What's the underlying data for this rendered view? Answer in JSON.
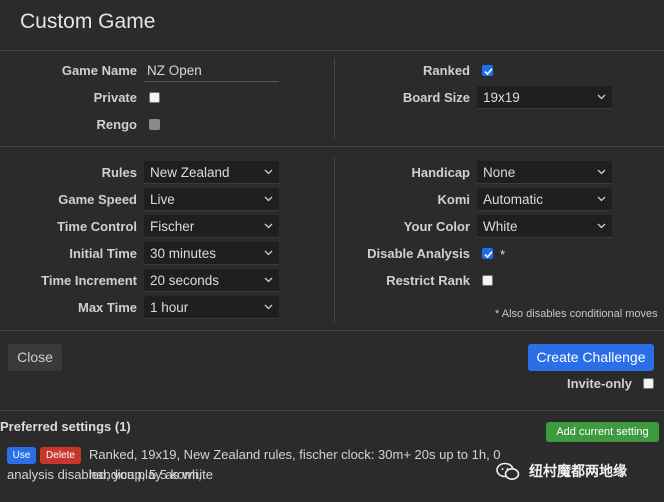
{
  "dialog": {
    "title": "Custom Game"
  },
  "left_top": {
    "game_name": {
      "label": "Game Name",
      "value": "NZ Open"
    },
    "private": {
      "label": "Private",
      "checked": false
    },
    "rengo": {
      "label": "Rengo",
      "checked": false,
      "disabled": true
    }
  },
  "right_top": {
    "ranked": {
      "label": "Ranked",
      "checked": true
    },
    "board_size": {
      "label": "Board Size",
      "value": "19x19"
    }
  },
  "left_bottom": {
    "rules": {
      "label": "Rules",
      "value": "New Zealand"
    },
    "game_speed": {
      "label": "Game Speed",
      "value": "Live"
    },
    "time_control": {
      "label": "Time Control",
      "value": "Fischer"
    },
    "initial_time": {
      "label": "Initial Time",
      "value": "30 minutes"
    },
    "time_increment": {
      "label": "Time Increment",
      "value": "20 seconds"
    },
    "max_time": {
      "label": "Max Time",
      "value": "1 hour"
    }
  },
  "right_bottom": {
    "handicap": {
      "label": "Handicap",
      "value": "None"
    },
    "komi": {
      "label": "Komi",
      "value": "Automatic"
    },
    "your_color": {
      "label": "Your Color",
      "value": "White"
    },
    "disable_analysis": {
      "label": "Disable Analysis",
      "checked": true,
      "asterisk": "*"
    },
    "restrict_rank": {
      "label": "Restrict Rank",
      "checked": false
    },
    "note": "* Also disables conditional moves"
  },
  "actions": {
    "close_label": "Close",
    "create_label": "Create Challenge",
    "invite_only": {
      "label": "Invite-only",
      "checked": false
    }
  },
  "preferred": {
    "title": "Preferred settings (1)",
    "add_label": "Add current setting",
    "items": [
      {
        "use_label": "Use",
        "delete_label": "Delete",
        "desc_line1": "Ranked, 19x19, New Zealand rules, fischer clock: 30m+ 20s up to 1h, 0 handicap, 5.5 komi,",
        "desc_line2": "analysis disabled, you play as white"
      }
    ]
  },
  "watermark": {
    "text": "纽村魔都两地缘"
  },
  "colors": {
    "background": "#2b2b2b",
    "primary": "#2a6ee8",
    "danger": "#c8372d",
    "success": "#3d9a3f"
  }
}
